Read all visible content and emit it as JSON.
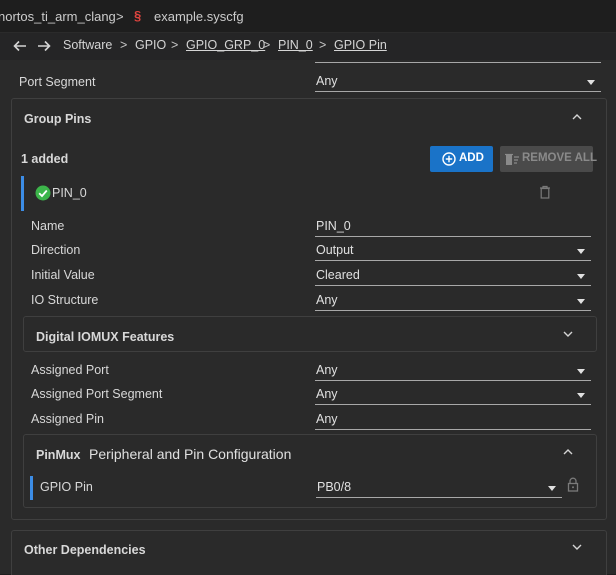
{
  "filebar": {
    "project": "nortos_ti_arm_clang",
    "file": "example.syscfg"
  },
  "breadcrumb": {
    "items": [
      "Software",
      "GPIO",
      "GPIO_GRP_0",
      "PIN_0",
      "GPIO Pin"
    ],
    "separator": ">"
  },
  "top": {
    "port_segment_label": "Port Segment",
    "port_segment_value": "Any"
  },
  "group_pins": {
    "title": "Group Pins",
    "count": "1 added",
    "add_label": "ADD",
    "remove_all_label": "REMOVE ALL",
    "pin_name": "PIN_0",
    "fields": [
      {
        "label": "Name",
        "value": "PIN_0"
      },
      {
        "label": "Direction",
        "value": "Output"
      },
      {
        "label": "Initial Value",
        "value": "Cleared"
      },
      {
        "label": "IO Structure",
        "value": "Any"
      }
    ]
  },
  "iomux": {
    "title": "Digital IOMUX Features",
    "fields": [
      {
        "label": "Assigned Port",
        "value": "Any"
      },
      {
        "label": "Assigned Port Segment",
        "value": "Any"
      },
      {
        "label": "Assigned Pin",
        "value": "Any"
      }
    ]
  },
  "pinmux": {
    "tag": "PinMux",
    "title": "Peripheral and Pin Configuration",
    "gpio_pin_label": "GPIO Pin",
    "gpio_pin_value": "PB0/8"
  },
  "other": {
    "title": "Other Dependencies"
  },
  "colors": {
    "accent_blue": "#1a73c8",
    "checkmark": "#3cb54a",
    "left_bar": "#3c8de6"
  }
}
